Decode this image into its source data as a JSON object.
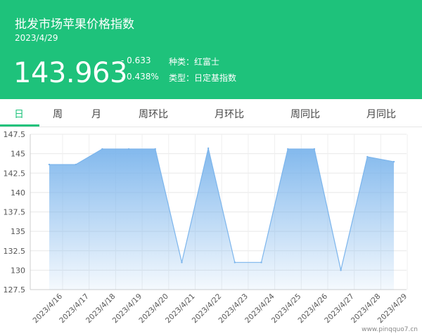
{
  "header": {
    "title": "批发市场苹果价格指数",
    "date": "2023/4/29",
    "price": "143.963",
    "change": "- 0.633",
    "change_pct": "↓0.438%",
    "kind": "种类：红富士",
    "type": "类型：日定基指数"
  },
  "tabs": [
    {
      "label": "日",
      "active": true
    },
    {
      "label": "周",
      "active": false
    },
    {
      "label": "月",
      "active": false
    },
    {
      "label": "周环比",
      "active": false
    },
    {
      "label": "月环比",
      "active": false
    },
    {
      "label": "周同比",
      "active": false
    },
    {
      "label": "月同比",
      "active": false
    }
  ],
  "colors": {
    "accent": "#1ec27b",
    "area": "#7cb5ec",
    "text_light": "#ffffff"
  },
  "chart_data": {
    "type": "area",
    "x": [
      "2023/4/16",
      "2023/4/17",
      "2023/4/18",
      "2023/4/19",
      "2023/4/20",
      "2023/4/21",
      "2023/4/22",
      "2023/4/23",
      "2023/4/24",
      "2023/4/25",
      "2023/4/26",
      "2023/4/27",
      "2023/4/28",
      "2023/4/29"
    ],
    "values": [
      143.6,
      143.6,
      145.6,
      145.6,
      145.6,
      131.0,
      145.7,
      131.0,
      131.0,
      145.6,
      145.6,
      130.0,
      144.6,
      143.963
    ],
    "yticks": [
      "127.5",
      "130",
      "132.5",
      "135",
      "137.5",
      "140",
      "142.5",
      "145",
      "147.5"
    ],
    "ylim": [
      127.5,
      147.5
    ],
    "grid": true,
    "legend": "none"
  },
  "watermark": "www.pinqquo7.cn"
}
